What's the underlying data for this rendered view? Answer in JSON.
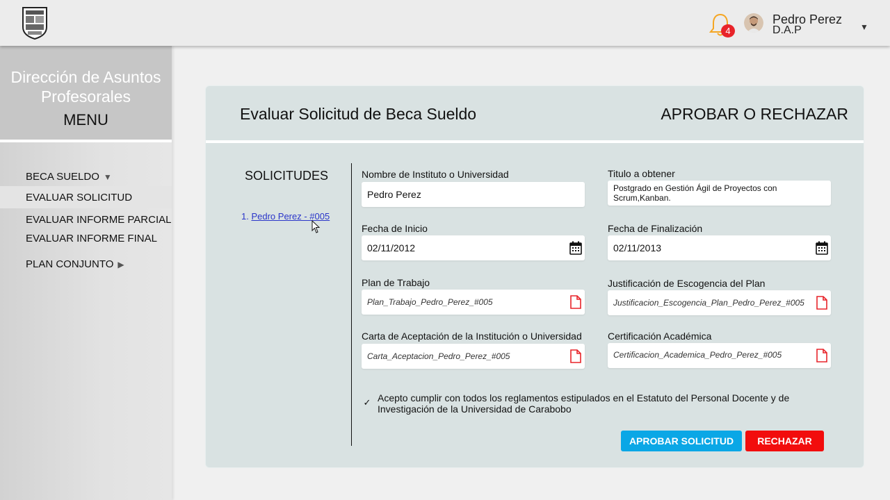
{
  "header": {
    "notification_count": "4",
    "user_name": "Pedro Perez",
    "user_role": "D.A.P"
  },
  "sidebar": {
    "title_line1": "Dirección de Asuntos",
    "title_line2": "Profesorales",
    "menu_label": "MENU",
    "items": [
      {
        "label": "BECA SUELDO",
        "caret": "▼"
      },
      {
        "label": "EVALUAR SOLICITUD"
      },
      {
        "label": "EVALUAR INFORME PARCIAL"
      },
      {
        "label": "EVALUAR INFORME FINAL"
      },
      {
        "label": "PLAN CONJUNTO",
        "caret": "▶"
      }
    ]
  },
  "card": {
    "title": "Evaluar Solicitud de Beca Sueldo",
    "action_title": "APROBAR O RECHAZAR",
    "solicitudes_title": "SOLICITUDES",
    "solicitudes": [
      {
        "number": "1.",
        "label": "Pedro Perez - #005"
      }
    ],
    "fields": {
      "institucion": {
        "label": "Nombre de Instituto o Universidad",
        "value": "Pedro Perez"
      },
      "titulo": {
        "label": "Titulo a obtener",
        "value": "Postgrado en Gestión Ágil de Proyectos con Scrum,Kanban."
      },
      "fecha_inicio": {
        "label": "Fecha de Inicio",
        "value": "02/11/2012",
        "icon": "calendar-icon"
      },
      "fecha_fin": {
        "label": "Fecha de Finalización",
        "value": "02/11/2013",
        "icon": "calendar-icon"
      },
      "plan_trabajo": {
        "label": "Plan de Trabajo",
        "value": "Plan_Trabajo_Pedro_Perez_#005",
        "icon": "file-icon"
      },
      "justificacion": {
        "label": "Justificación de Escogencia del Plan",
        "value": "Justificacion_Escogencia_Plan_Pedro_Perez_#005",
        "icon": "file-icon"
      },
      "carta": {
        "label": "Carta de Aceptación de la Institución o Universidad",
        "value": "Carta_Aceptacion_Pedro_Perez_#005",
        "icon": "file-icon"
      },
      "certificacion": {
        "label": "Certificación Académica",
        "value": "Certificacion_Academica_Pedro_Perez_#005",
        "icon": "file-icon"
      }
    },
    "agreement": {
      "checked": true,
      "mark": "✓",
      "text": "Acepto cumplir con todos los reglamentos estipulados en el Estatuto del Personal Docente y de Investigación de la Universidad de Carabobo"
    },
    "buttons": {
      "approve": "APROBAR SOLICITUD",
      "reject": "RECHAZAR"
    }
  },
  "colors": {
    "approve": "#0aa7e6",
    "reject": "#f20d0d",
    "notification_badge": "#e8242a",
    "card_background": "#d9e2e2",
    "link": "#2a35c9"
  }
}
